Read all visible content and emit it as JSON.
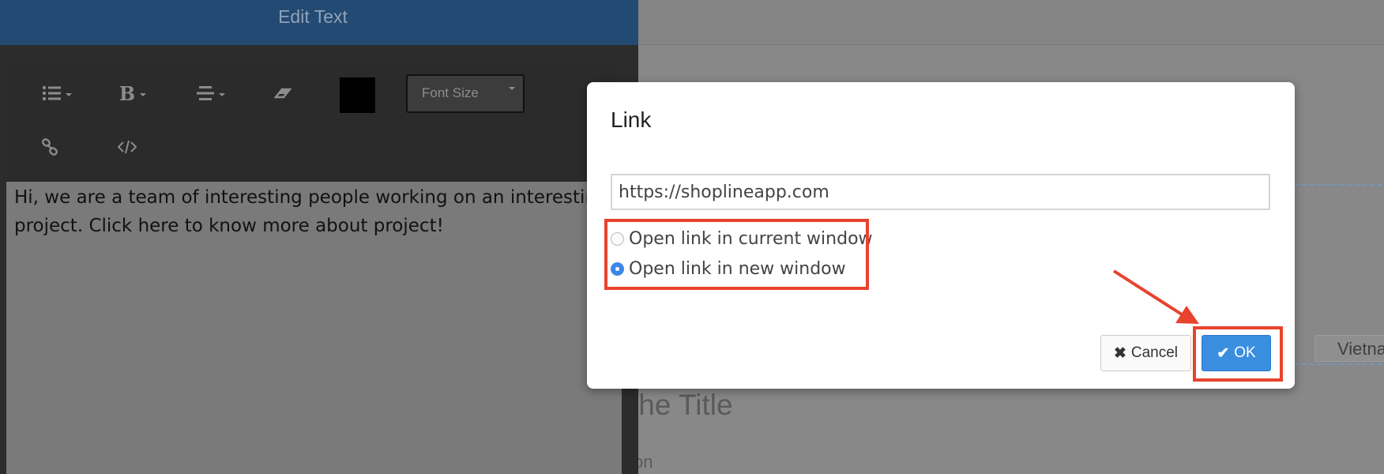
{
  "editor": {
    "title": "Edit Text",
    "toolbar": {
      "font_size_label": "Font Size",
      "color_value": "#000000"
    },
    "content": "Hi, we are a team of interesting people working on an interesting project. Click here to know more about project!"
  },
  "background_page": {
    "title_fragment": "the Title",
    "subtitle_fragment": "on",
    "tab_label": "Vietna"
  },
  "dialog": {
    "title": "Link",
    "url_value": "https://shoplineapp.com",
    "options": [
      {
        "label": "Open link in current window",
        "checked": false
      },
      {
        "label": "Open link in new window",
        "checked": true
      }
    ],
    "cancel_label": "Cancel",
    "ok_label": "OK"
  },
  "colors": {
    "header": "#234a72",
    "primary_button": "#3a8ee0",
    "annotation": "#e8432e"
  }
}
